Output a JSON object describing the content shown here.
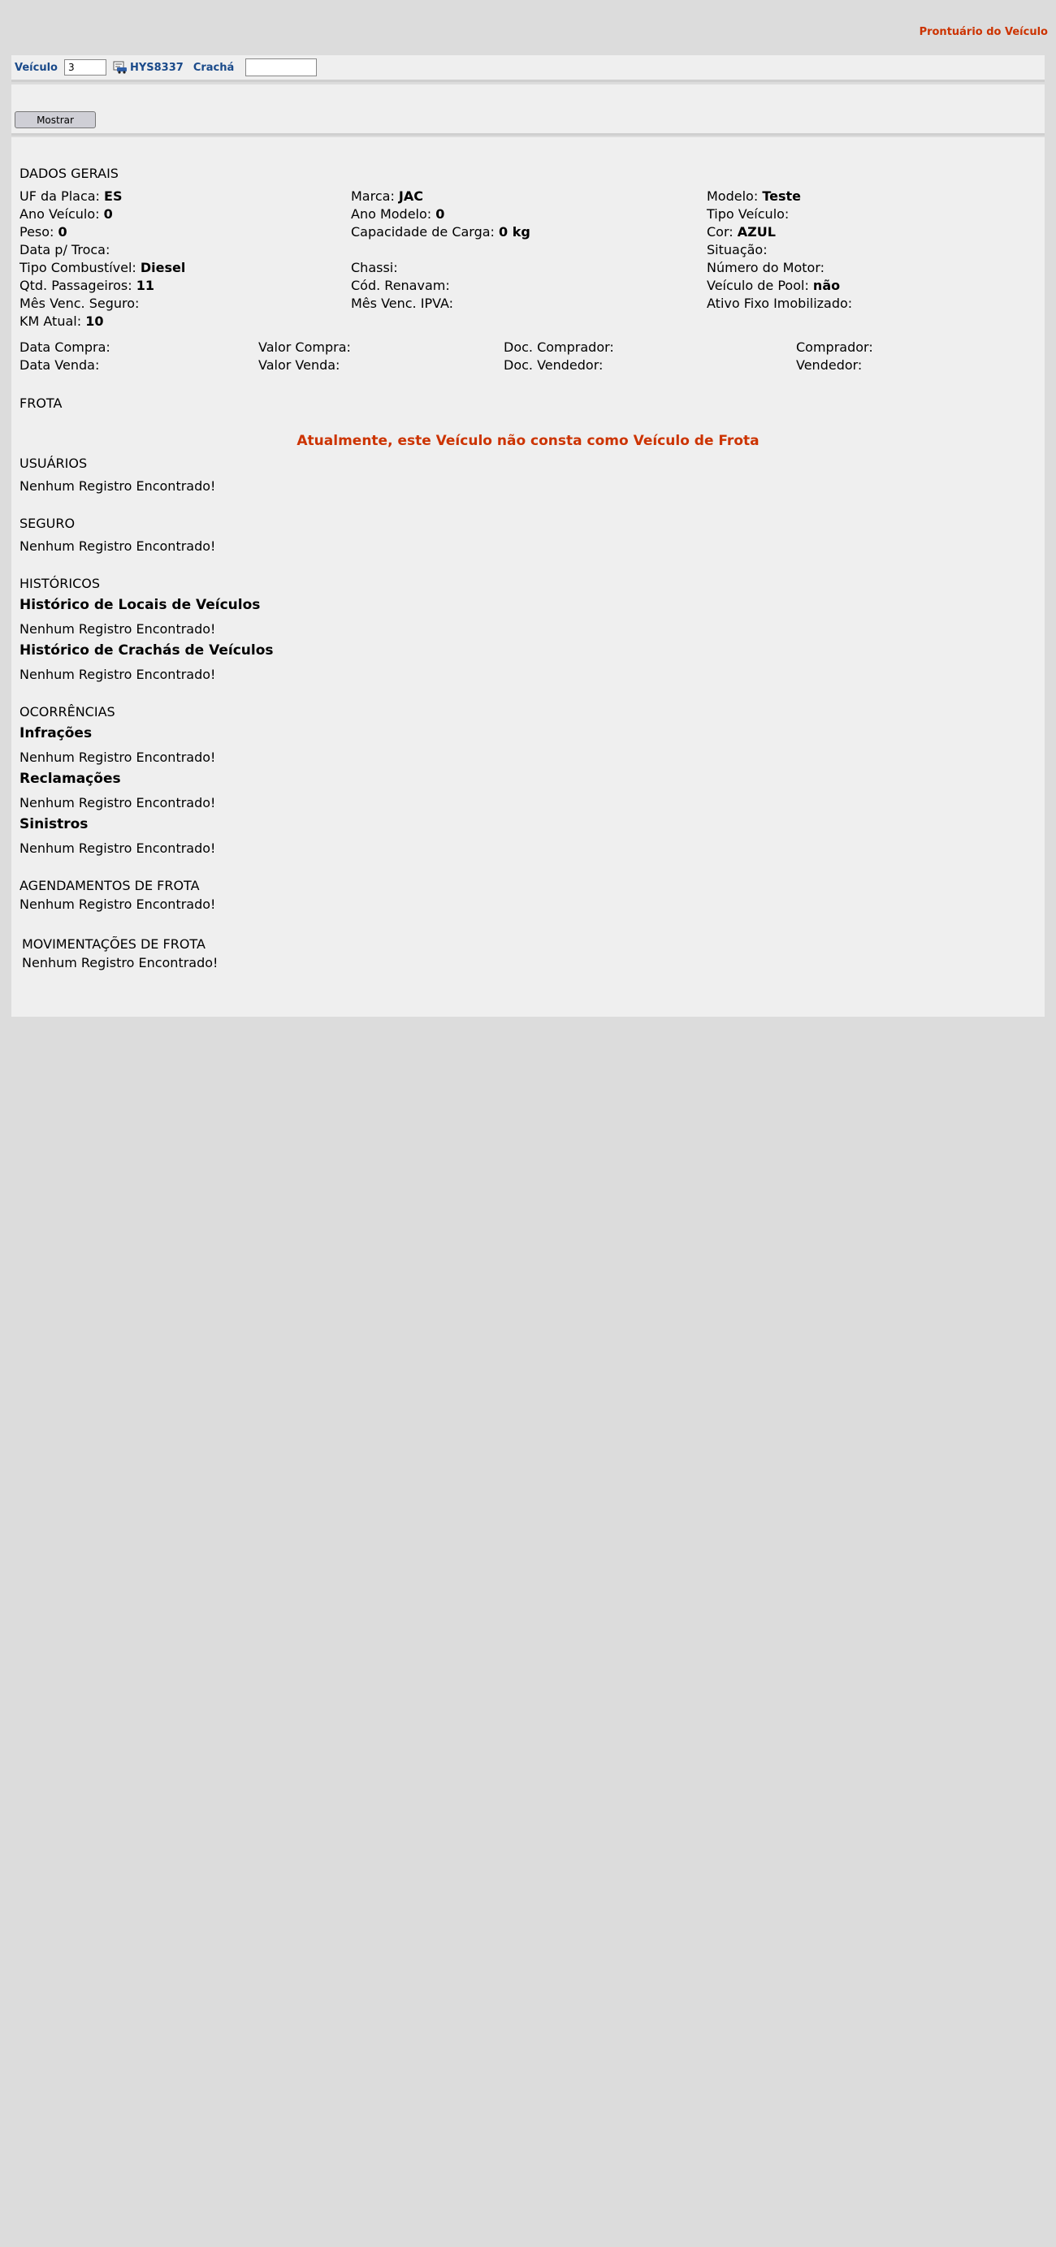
{
  "header": {
    "title": "Prontuário do Veículo"
  },
  "filter": {
    "veiculo_label": "Veículo",
    "veiculo_value": "3",
    "plate": "HYS8337",
    "cracha_label": "Crachá",
    "cracha_value": ""
  },
  "actions": {
    "mostrar_label": "Mostrar"
  },
  "dados_gerais": {
    "title": "DADOS GERAIS",
    "uf_placa": {
      "label": "UF da Placa: ",
      "value": "ES"
    },
    "marca": {
      "label": "Marca: ",
      "value": "JAC"
    },
    "modelo": {
      "label": "Modelo: ",
      "value": "Teste"
    },
    "ano_veiculo": {
      "label": "Ano Veículo: ",
      "value": "0"
    },
    "ano_modelo": {
      "label": "Ano Modelo: ",
      "value": "0"
    },
    "tipo_veiculo": {
      "label": "Tipo Veículo:",
      "value": ""
    },
    "peso": {
      "label": "Peso: ",
      "value": "0"
    },
    "capacidade_carga": {
      "label": "Capacidade de Carga: ",
      "value": "0 kg"
    },
    "cor": {
      "label": "Cor: ",
      "value": "AZUL"
    },
    "data_troca": {
      "label": "Data p/ Troca:",
      "value": ""
    },
    "situacao": {
      "label": "Situação:",
      "value": ""
    },
    "tipo_combustivel": {
      "label": "Tipo Combustível: ",
      "value": "Diesel"
    },
    "chassi": {
      "label": "Chassi:",
      "value": ""
    },
    "numero_motor": {
      "label": "Número do Motor:",
      "value": ""
    },
    "qtd_passageiros": {
      "label": "Qtd. Passageiros: ",
      "value": "11"
    },
    "cod_renavam": {
      "label": "Cód. Renavam:",
      "value": ""
    },
    "veiculo_pool": {
      "label": "Veículo de Pool: ",
      "value": "não"
    },
    "mes_venc_seguro": {
      "label": "Mês Venc. Seguro:",
      "value": ""
    },
    "mes_venc_ipva": {
      "label": "Mês Venc. IPVA:",
      "value": ""
    },
    "ativo_fixo": {
      "label": "Ativo Fixo Imobilizado:",
      "value": ""
    },
    "km_atual": {
      "label": "KM Atual: ",
      "value": "10"
    },
    "data_compra": "Data Compra:",
    "valor_compra": "Valor Compra:",
    "doc_comprador": "Doc. Comprador:",
    "comprador": "Comprador:",
    "data_venda": "Data Venda:",
    "valor_venda": "Valor Venda:",
    "doc_vendedor": "Doc. Vendedor:",
    "vendedor": "Vendedor:"
  },
  "frota": {
    "title": "FROTA",
    "message": "Atualmente, este Veículo não consta como Veículo de Frota"
  },
  "usuarios": {
    "title": "USUÁRIOS",
    "empty": "Nenhum Registro Encontrado!"
  },
  "seguro": {
    "title": "SEGURO",
    "empty": "Nenhum Registro Encontrado!"
  },
  "historicos": {
    "title": "HISTÓRICOS",
    "locais_title": "Histórico de Locais de Veículos",
    "locais_empty": "Nenhum Registro Encontrado!",
    "crachas_title": "Histórico de Crachás de Veículos",
    "crachas_empty": "Nenhum Registro Encontrado!"
  },
  "ocorrencias": {
    "title": "OCORRÊNCIAS",
    "infracoes_title": "Infrações",
    "infracoes_empty": "Nenhum Registro Encontrado!",
    "reclamacoes_title": "Reclamações",
    "reclamacoes_empty": "Nenhum Registro Encontrado!",
    "sinistros_title": "Sinistros",
    "sinistros_empty": "Nenhum Registro Encontrado!"
  },
  "agendamentos": {
    "title": "AGENDAMENTOS DE FROTA",
    "empty": "Nenhum Registro Encontrado!"
  },
  "movimentacoes": {
    "title": "MOVIMENTAÇÕES DE FROTA",
    "empty": "Nenhum Registro Encontrado!"
  }
}
